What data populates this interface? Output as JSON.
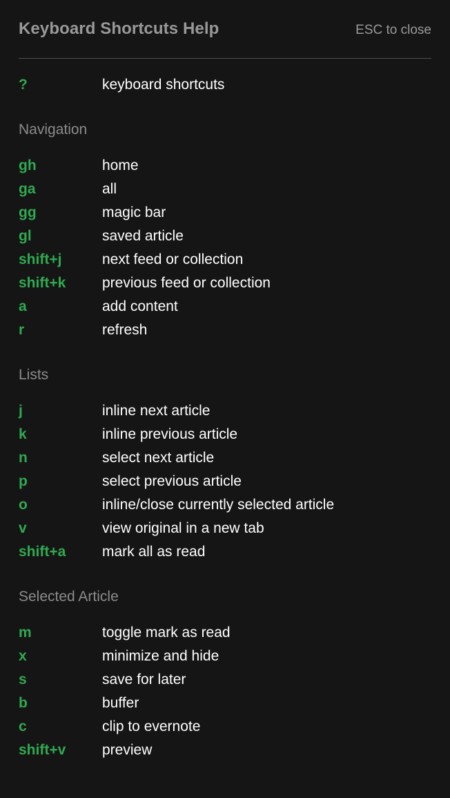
{
  "header": {
    "title": "Keyboard Shortcuts Help",
    "esc_hint": "ESC to close"
  },
  "colors": {
    "background": "#151515",
    "key_accent": "#2faa51",
    "description": "#ffffff",
    "section_title": "#8c8c8c",
    "header_title": "#999999",
    "divider": "#4e4e4e"
  },
  "global_shortcuts": [
    {
      "key": "?",
      "description": "keyboard shortcuts"
    }
  ],
  "sections": [
    {
      "title": "Navigation",
      "shortcuts": [
        {
          "key": "gh",
          "description": "home"
        },
        {
          "key": "ga",
          "description": "all"
        },
        {
          "key": "gg",
          "description": "magic bar"
        },
        {
          "key": "gl",
          "description": "saved article"
        },
        {
          "key": "shift+j",
          "description": "next feed or collection"
        },
        {
          "key": "shift+k",
          "description": "previous feed or collection"
        },
        {
          "key": "a",
          "description": "add content"
        },
        {
          "key": "r",
          "description": "refresh"
        }
      ]
    },
    {
      "title": "Lists",
      "shortcuts": [
        {
          "key": "j",
          "description": "inline next article"
        },
        {
          "key": "k",
          "description": "inline previous article"
        },
        {
          "key": "n",
          "description": "select next article"
        },
        {
          "key": "p",
          "description": "select previous article"
        },
        {
          "key": "o",
          "description": "inline/close currently selected article"
        },
        {
          "key": "v",
          "description": "view original in a new tab"
        },
        {
          "key": "shift+a",
          "description": "mark all as read"
        }
      ]
    },
    {
      "title": "Selected Article",
      "shortcuts": [
        {
          "key": "m",
          "description": "toggle mark as read"
        },
        {
          "key": "x",
          "description": "minimize and hide"
        },
        {
          "key": "s",
          "description": "save for later"
        },
        {
          "key": "b",
          "description": "buffer"
        },
        {
          "key": "c",
          "description": "clip to evernote"
        },
        {
          "key": "shift+v",
          "description": "preview"
        }
      ]
    }
  ]
}
